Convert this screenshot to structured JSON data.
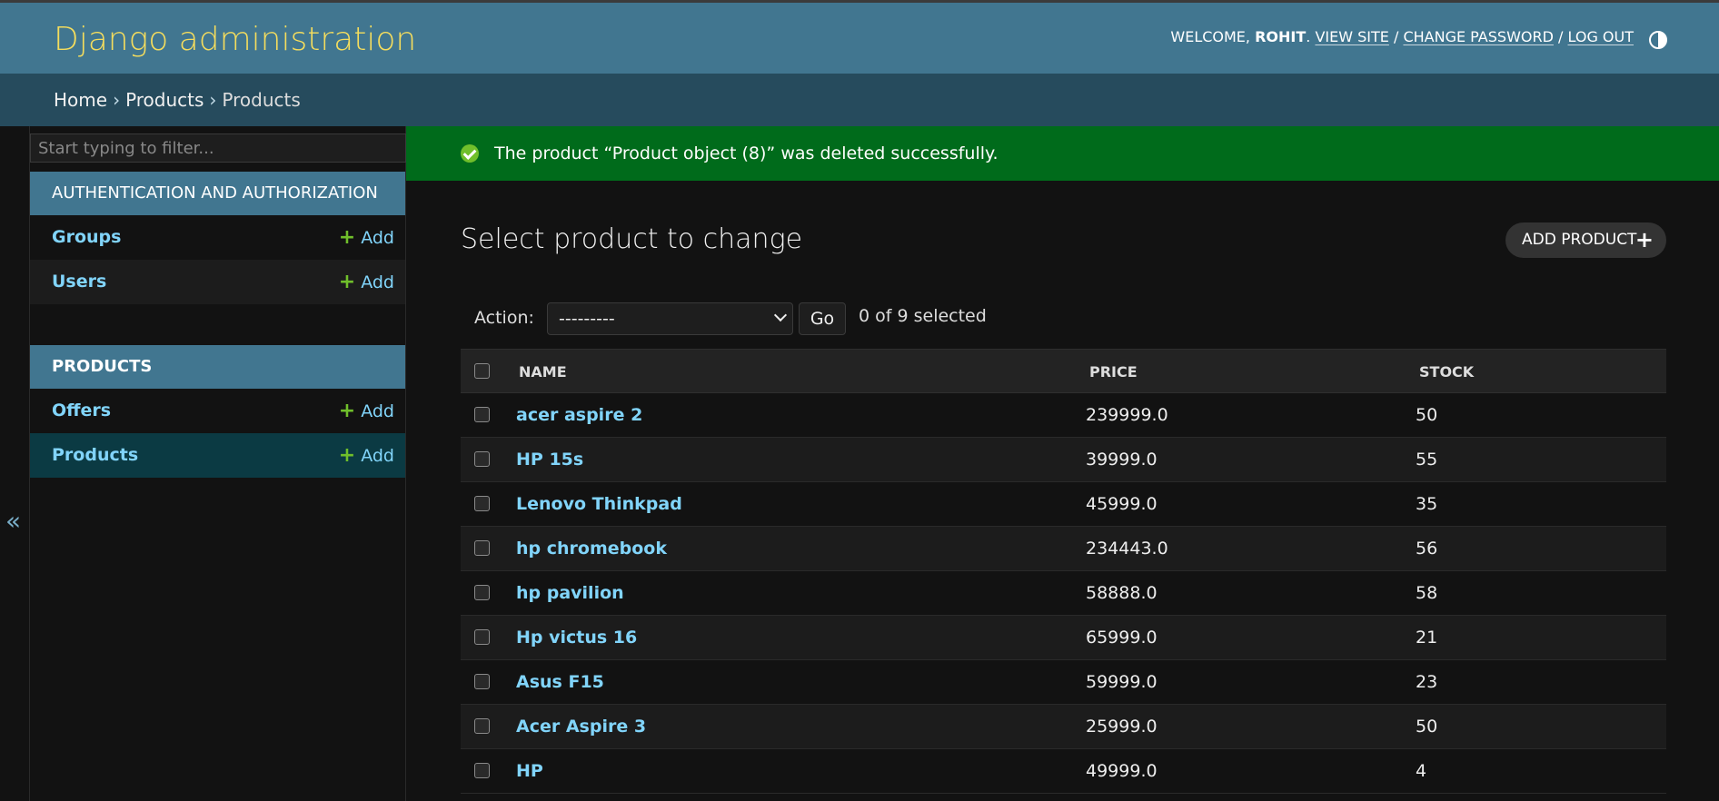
{
  "header": {
    "site_title": "Django administration",
    "welcome": "Welcome,",
    "username": "Rohit",
    "view_site": "View site",
    "change_password": "Change password",
    "log_out": "Log out",
    "separator": "/",
    "theme_toggle_icon": "theme-toggle-icon"
  },
  "breadcrumbs": {
    "items": [
      "Home",
      "Products",
      "Products"
    ],
    "separator": "›"
  },
  "sidebar": {
    "filter_placeholder": "Start typing to filter...",
    "collapse_icon": "«",
    "apps": [
      {
        "caption": "Authentication and Authorization",
        "models": [
          {
            "name": "Groups",
            "add_label": "Add"
          },
          {
            "name": "Users",
            "add_label": "Add"
          }
        ]
      },
      {
        "caption": "Products",
        "models": [
          {
            "name": "Offers",
            "add_label": "Add"
          },
          {
            "name": "Products",
            "add_label": "Add"
          }
        ]
      }
    ]
  },
  "message": {
    "text": "The product “Product object (8)” was deleted successfully.",
    "icon": "success-check-icon"
  },
  "main": {
    "title": "Select product to change",
    "add_button_label": "Add product",
    "add_icon": "+",
    "action_label": "Action:",
    "action_selected": "---------",
    "go_label": "Go",
    "selected_count": "0 of 9 selected",
    "columns": [
      "Name",
      "Price",
      "Stock"
    ],
    "rows": [
      {
        "name": "acer aspire 2",
        "price": "239999.0",
        "stock": "50"
      },
      {
        "name": "HP 15s",
        "price": "39999.0",
        "stock": "55"
      },
      {
        "name": "Lenovo Thinkpad",
        "price": "45999.0",
        "stock": "35"
      },
      {
        "name": "hp chromebook",
        "price": "234443.0",
        "stock": "56"
      },
      {
        "name": "hp pavilion",
        "price": "58888.0",
        "stock": "58"
      },
      {
        "name": "Hp victus 16",
        "price": "65999.0",
        "stock": "21"
      },
      {
        "name": "Asus F15",
        "price": "59999.0",
        "stock": "23"
      },
      {
        "name": "Acer Aspire 3",
        "price": "25999.0",
        "stock": "50"
      },
      {
        "name": "HP",
        "price": "49999.0",
        "stock": "4"
      }
    ]
  },
  "colors": {
    "header_bg": "#417690",
    "breadcrumb_bg": "#264b5d",
    "site_title": "#f5dd5d",
    "link": "#81d4fa",
    "success_bg": "#006b1b",
    "add_plus": "#70bf2b",
    "selected_row_bg": "#0b3a43"
  }
}
